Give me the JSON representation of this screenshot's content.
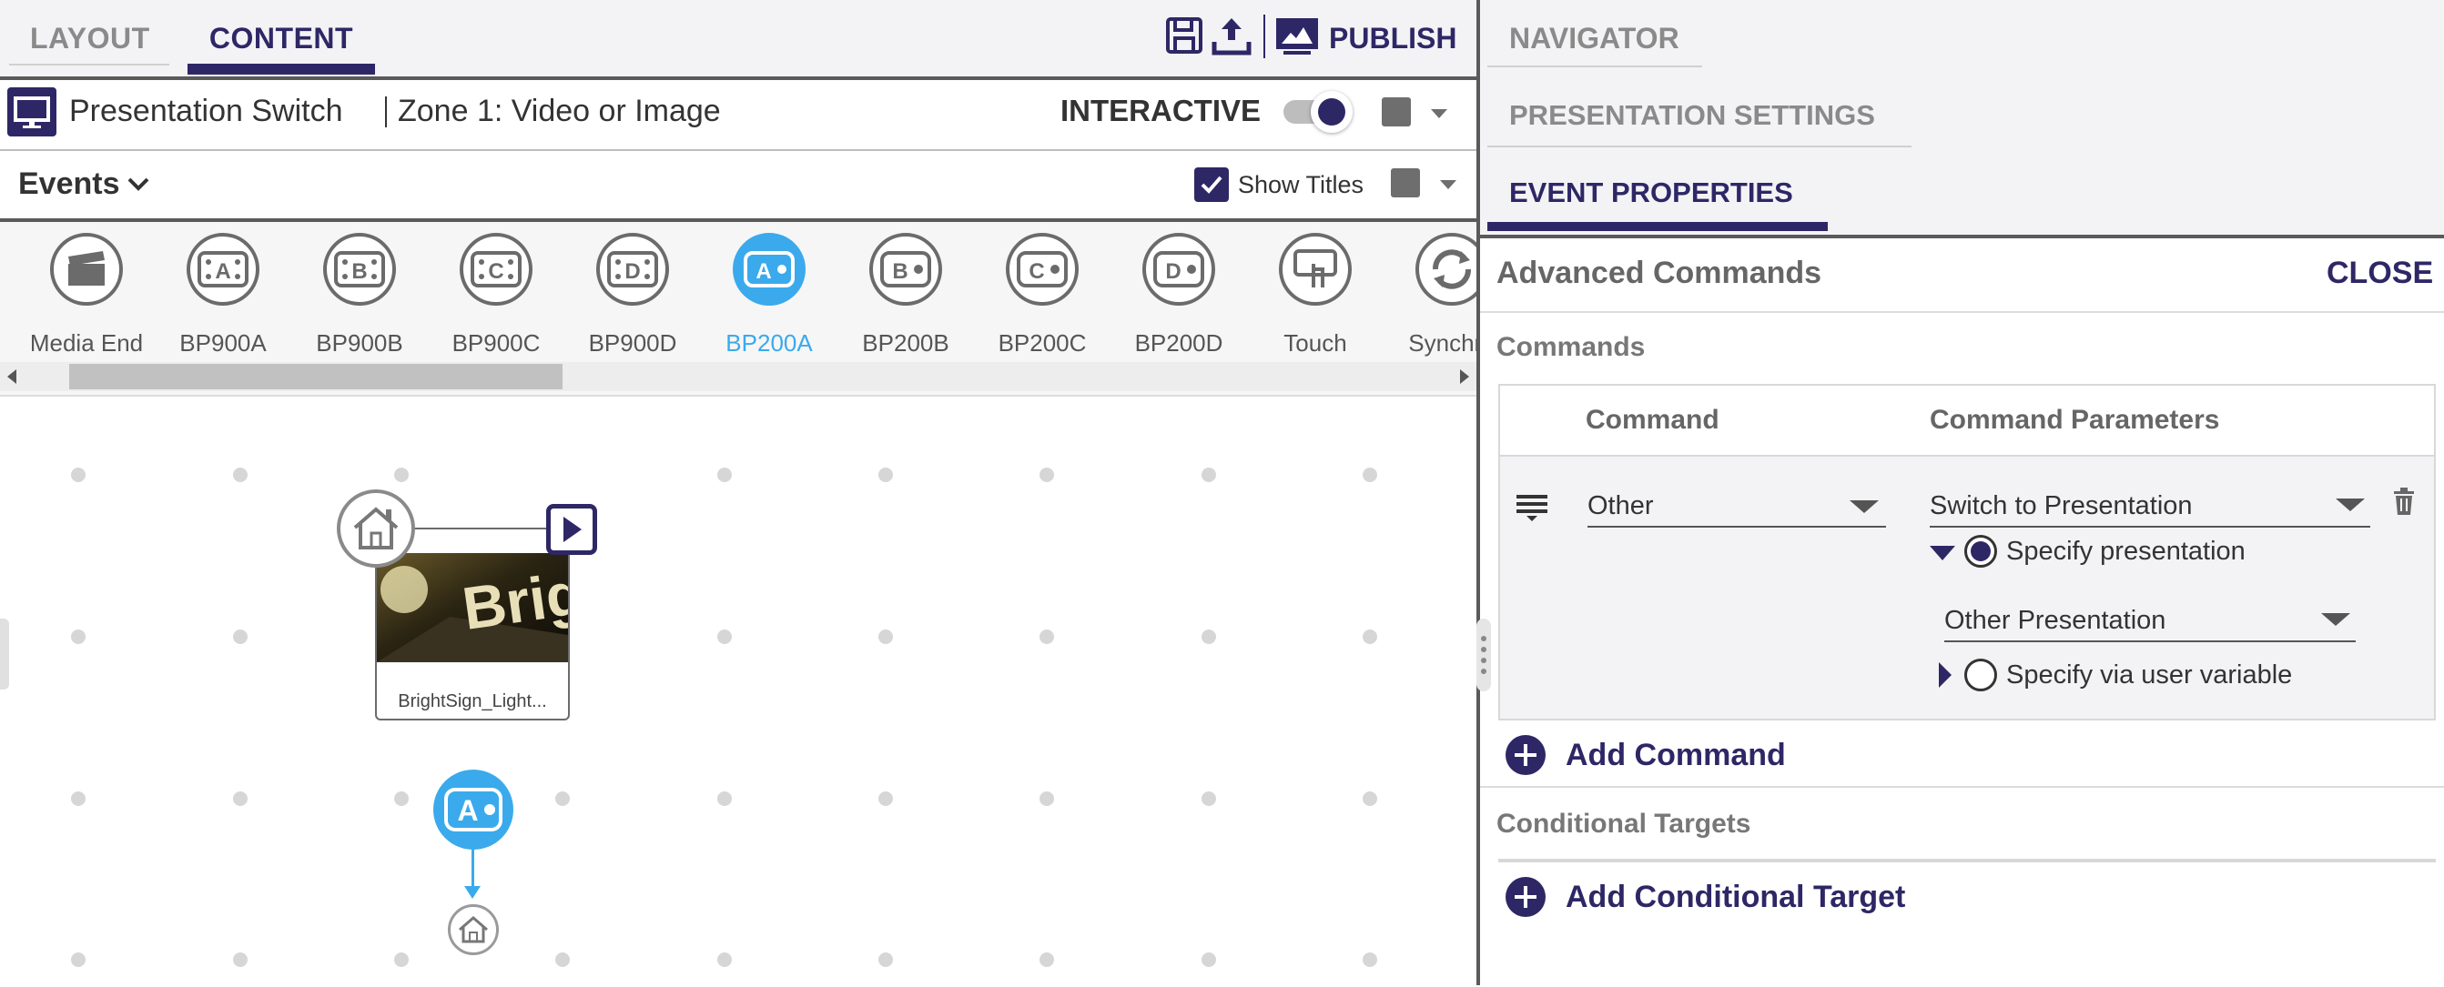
{
  "topbar": {
    "tabs": [
      "LAYOUT",
      "CONTENT"
    ],
    "active_tab": "CONTENT",
    "publish_label": "PUBLISH"
  },
  "zone": {
    "presentation_name": "Presentation Switch",
    "zone_name": "Zone 1: Video or Image",
    "interactive_label": "INTERACTIVE",
    "interactive_on": true
  },
  "events_bar": {
    "label": "Events",
    "show_titles_label": "Show Titles",
    "show_titles_checked": true
  },
  "palette": {
    "items": [
      {
        "label": "Media End",
        "icon": "clapper-icon",
        "glyph": ""
      },
      {
        "label": "BP900A",
        "icon": "bp900-icon",
        "glyph": "A"
      },
      {
        "label": "BP900B",
        "icon": "bp900-icon",
        "glyph": "B"
      },
      {
        "label": "BP900C",
        "icon": "bp900-icon",
        "glyph": "C"
      },
      {
        "label": "BP900D",
        "icon": "bp900-icon",
        "glyph": "D"
      },
      {
        "label": "BP200A",
        "icon": "bp200-icon",
        "glyph": "A"
      },
      {
        "label": "BP200B",
        "icon": "bp200-icon",
        "glyph": "B"
      },
      {
        "label": "BP200C",
        "icon": "bp200-icon",
        "glyph": "C"
      },
      {
        "label": "BP200D",
        "icon": "bp200-icon",
        "glyph": "D"
      },
      {
        "label": "Touch",
        "icon": "touch-icon",
        "glyph": ""
      },
      {
        "label": "Synchro",
        "icon": "sync-icon",
        "glyph": ""
      }
    ],
    "selected": "BP200A"
  },
  "canvas": {
    "media_label": "BrightSign_Light...",
    "thumb_text": "Brig",
    "event_glyph": "A"
  },
  "right": {
    "navigator_label": "NAVIGATOR",
    "presentation_settings_label": "PRESENTATION SETTINGS",
    "event_properties_label": "EVENT PROPERTIES",
    "advanced_title": "Advanced Commands",
    "close_label": "CLOSE",
    "commands_title": "Commands",
    "col_command": "Command",
    "col_params": "Command Parameters",
    "row": {
      "command_value": "Other",
      "param_value": "Switch to Presentation",
      "option_specify": "Specify presentation",
      "option_specify_selected": true,
      "presentation_value": "Other Presentation",
      "option_variable": "Specify via user variable"
    },
    "add_command_label": "Add Command",
    "conditional_title": "Conditional Targets",
    "add_conditional_label": "Add Conditional Target"
  },
  "colors": {
    "brand": "#2e2766",
    "accent": "#3aaaec",
    "muted": "#8a8a8a"
  }
}
